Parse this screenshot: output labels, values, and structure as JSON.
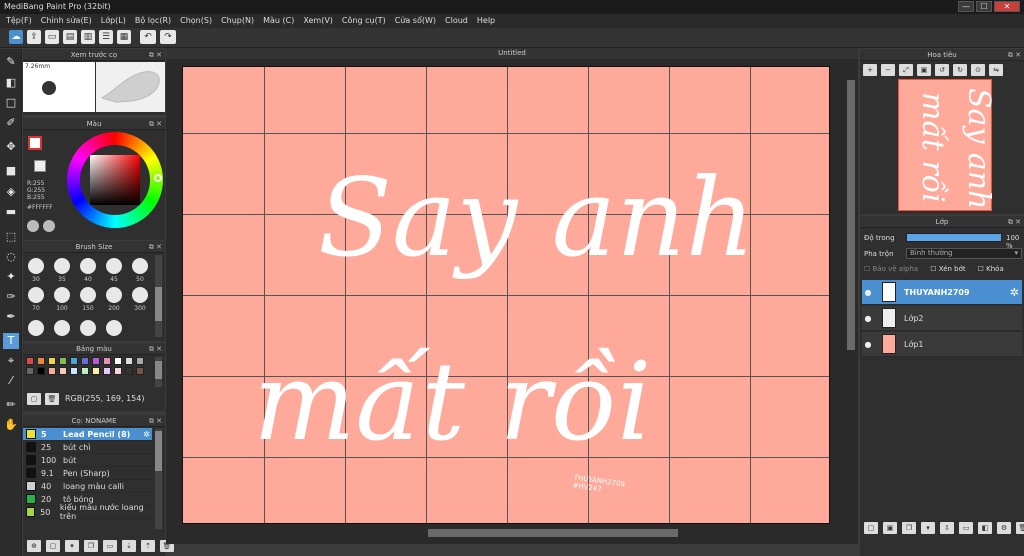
{
  "app": {
    "title": "MediBang Paint Pro (32bit)",
    "win_min": "—",
    "win_max": "☐",
    "win_close": "✕"
  },
  "menu": [
    "Tệp(F)",
    "Chỉnh sửa(E)",
    "Lớp(L)",
    "Bộ lọc(R)",
    "Chọn(S)",
    "Chụp(N)",
    "Màu (C)",
    "Xem(V)",
    "Công cụ(T)",
    "Cửa sổ(W)",
    "Cloud",
    "Help"
  ],
  "preview": {
    "title": "Xem trước cọ",
    "size": "7.26mm"
  },
  "color": {
    "title": "Màu",
    "r": "R:255",
    "g": "G:255",
    "b": "B:255",
    "hex": "#FFFFFF"
  },
  "brushsize": {
    "title": "Brush Size",
    "row1": [
      "30",
      "35",
      "40",
      "45",
      "50"
    ],
    "row2": [
      "70",
      "100",
      "150",
      "200",
      "300"
    ]
  },
  "palette": {
    "title": "Bảng màu",
    "value": "RGB(255, 169, 154)"
  },
  "brush": {
    "title": "Cọ: NONAME",
    "items": [
      {
        "size": "5",
        "name": "Lead Pencil (8)",
        "color": "#e7e23a",
        "selected": true
      },
      {
        "size": "25",
        "name": "bút chì",
        "color": "#111111",
        "selected": false
      },
      {
        "size": "100",
        "name": "bút",
        "color": "#111111",
        "selected": false
      },
      {
        "size": "9.1",
        "name": "Pen (Sharp)",
        "color": "#111111",
        "selected": false
      },
      {
        "size": "40",
        "name": "loang màu calli",
        "color": "#cfcfcf",
        "selected": false
      },
      {
        "size": "20",
        "name": "tô bóng",
        "color": "#2bb04a",
        "selected": false
      },
      {
        "size": "50",
        "name": "kiểu màu nước loang trên",
        "color": "#a6d64a",
        "selected": false
      }
    ]
  },
  "canvas": {
    "tab": "Untitled",
    "line1": "Say anh",
    "line2": "mất rồi",
    "watermark1": "THUYANH2709",
    "watermark2": "#HV247",
    "bg_color": "#ffa99a"
  },
  "navigator": {
    "title": "Hoa tiêu"
  },
  "layers": {
    "title": "Lớp",
    "opacity_label": "Độ trong",
    "opacity_value": "100 %",
    "blend_label": "Pha trộn",
    "blend_value": "Bình thường",
    "protect_alpha": "Bảo vệ alpha",
    "clip": "Xén bớt",
    "lock": "Khóa",
    "items": [
      {
        "name": "THUYANH2709",
        "selected": true
      },
      {
        "name": "Lớp2",
        "selected": false
      },
      {
        "name": "Lớp1",
        "selected": false
      }
    ]
  }
}
